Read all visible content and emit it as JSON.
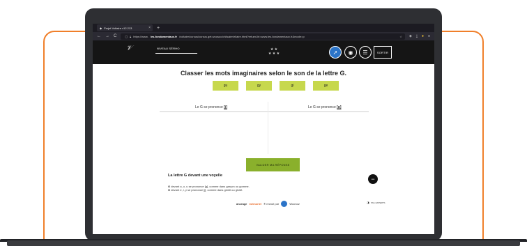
{
  "colors": {
    "accent_orange": "#f07f2a",
    "chip_green": "#c7d84d",
    "button_green": "#8ab02c",
    "header_black": "#151515",
    "active_blue": "#2b74c8"
  },
  "browser": {
    "tab_title": "Projet Voltaire v12.213",
    "tab_close": "×",
    "new_tab": "+",
    "nav_back": "←",
    "nav_forward": "→",
    "nav_reload": "C",
    "url_prefix": "https://www.",
    "url_domain": "les-fondamentaux.fr",
    "url_rest": "/voltaire/cursus/cursus.get.woosoc/chilsaire/eliaire.html?returnUrl=www.les-fondamentaux.fr&mode=p"
  },
  "header": {
    "level_label": "NIVEAU SÉRHO",
    "stars_top": "★ ★",
    "stars_bottom": "★ ★ ★",
    "exit_label": "SORTIR",
    "icons": [
      "compass-icon",
      "eye-icon",
      "list-icon"
    ]
  },
  "exercise": {
    "title": "Classer les mots imaginaires selon le son de la lettre G.",
    "words": [
      "gu",
      "gy",
      "gi",
      "ge"
    ],
    "column_left": "Le G se prononce ",
    "column_left_sound": "[j]",
    "column_right": "Le G se prononce ",
    "column_right_sound": "[g]",
    "validate_label": "VALIDER MA RÉPONSE"
  },
  "rule": {
    "title": "La lettre G devant une voyelle",
    "line1_start": "G",
    "line1_rest": " devant a, o, u se prononce [g], comme dans garçon ou gomme.",
    "line2_start": "G",
    "line2_rest": " devant e, i, y se prononce [j], comme dans gentil ou gîcité."
  },
  "footer": {
    "brand_start": "ancrage",
    "brand_accent": "mémoriel",
    "brand_rest": "® recruit par",
    "partner": "Woonoz",
    "right_text": "TAG EXPERTS"
  }
}
